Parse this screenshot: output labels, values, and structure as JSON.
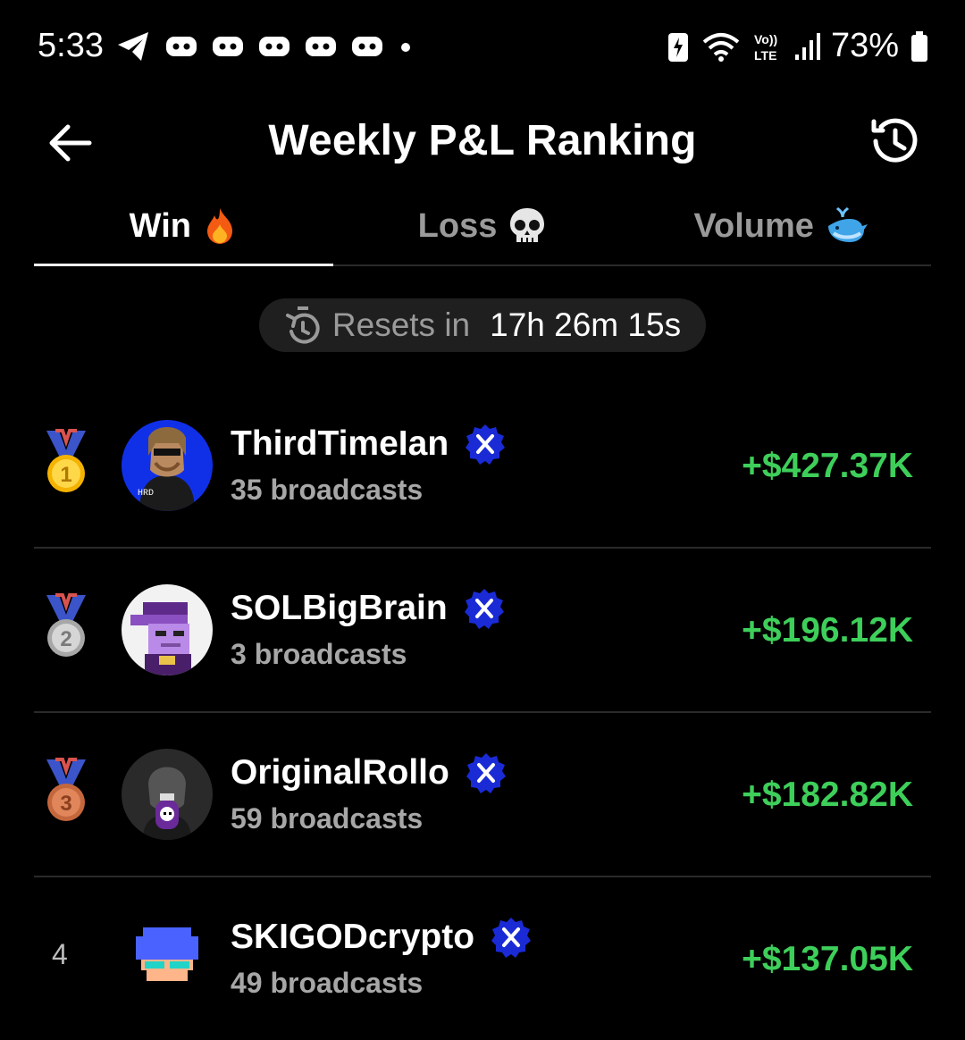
{
  "status_bar": {
    "time": "5:33",
    "battery": "73%",
    "network": "LTE"
  },
  "header": {
    "title": "Weekly P&L Ranking"
  },
  "tabs": [
    {
      "label": "Win",
      "active": true,
      "emoji_icon": "fire-icon"
    },
    {
      "label": "Loss",
      "active": false,
      "emoji_icon": "skull-icon"
    },
    {
      "label": "Volume",
      "active": false,
      "emoji_icon": "whale-icon"
    }
  ],
  "reset": {
    "label": "Resets in",
    "timer": "17h 26m 15s"
  },
  "colors": {
    "positive": "#3ecf5a",
    "badge_blue": "#1a2bd6"
  },
  "leaders": [
    {
      "rank": "1",
      "medal": "gold",
      "name": "ThirdTimeIan",
      "broadcasts": "35 broadcasts",
      "pnl": "+$427.37K"
    },
    {
      "rank": "2",
      "medal": "silver",
      "name": "SOLBigBrain",
      "broadcasts": "3 broadcasts",
      "pnl": "+$196.12K"
    },
    {
      "rank": "3",
      "medal": "bronze",
      "name": "OriginalRollo",
      "broadcasts": "59 broadcasts",
      "pnl": "+$182.82K"
    },
    {
      "rank": "4",
      "medal": "",
      "name": "SKIGODcrypto",
      "broadcasts": "49 broadcasts",
      "pnl": "+$137.05K"
    }
  ]
}
